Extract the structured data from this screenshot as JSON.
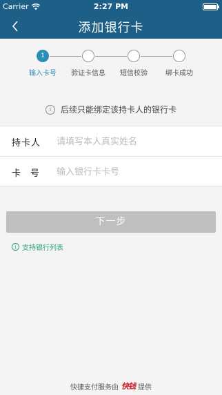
{
  "status_bar": {
    "carrier": "Carrier",
    "time": "2:27 PM"
  },
  "nav": {
    "title": "添加银行卡",
    "back_icon": "chevron-left-icon"
  },
  "steps": [
    {
      "number": "1",
      "label": "输入卡号",
      "active": true
    },
    {
      "number": "",
      "label": "验证卡信息",
      "active": false
    },
    {
      "number": "",
      "label": "短信校验",
      "active": false
    },
    {
      "number": "",
      "label": "绑卡成功",
      "active": false
    }
  ],
  "notice": {
    "text": "后续只能绑定该持卡人的银行卡",
    "icon": "info-icon"
  },
  "form": {
    "holder_label": "持卡人",
    "holder_value": "",
    "holder_placeholder": "请填写本人真实姓名",
    "card_label": "卡号",
    "card_value": "",
    "card_placeholder": "输入银行卡卡号"
  },
  "next_button": "下一步",
  "bank_list_link": "支持银行列表",
  "footer": {
    "prefix": "快捷支付服务由",
    "logo": "快钱",
    "suffix": "提供"
  },
  "colors": {
    "header": "#1d5f86",
    "accent": "#2b8fb3",
    "link": "#2aa47c",
    "button": "#bfbfbf",
    "logo": "#d01d28"
  }
}
